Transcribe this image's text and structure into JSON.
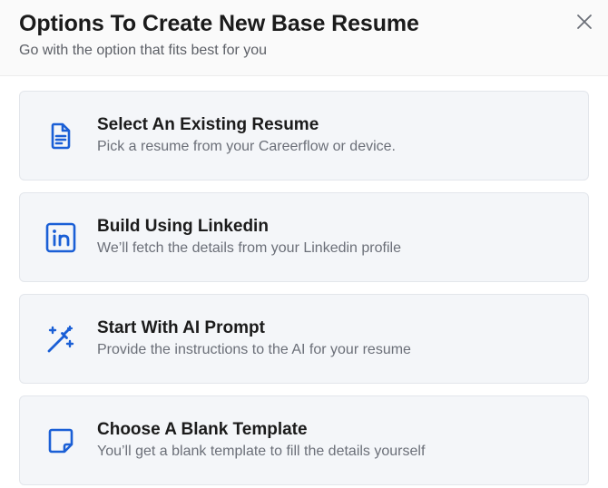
{
  "dialog": {
    "title": "Options To Create New Base Resume",
    "subtitle": "Go with the option that fits best for you",
    "close_icon": "close-icon"
  },
  "options": [
    {
      "icon": "document-icon",
      "title": "Select An Existing Resume",
      "description": "Pick a resume from your Careerflow or device."
    },
    {
      "icon": "linkedin-icon",
      "title": "Build Using Linkedin",
      "description": "We’ll fetch the details from your Linkedin profile"
    },
    {
      "icon": "magic-wand-icon",
      "title": "Start With AI Prompt",
      "description": "Provide the instructions to the AI for your resume"
    },
    {
      "icon": "blank-note-icon",
      "title": "Choose A Blank Template",
      "description": "You’ll get a blank template to fill the details yourself"
    }
  ],
  "colors": {
    "accent": "#1a5fd6",
    "card_background": "#f4f6f9",
    "card_border": "#e3e6eb",
    "title_text": "#1b1b1b",
    "muted_text": "#6b6f78"
  }
}
